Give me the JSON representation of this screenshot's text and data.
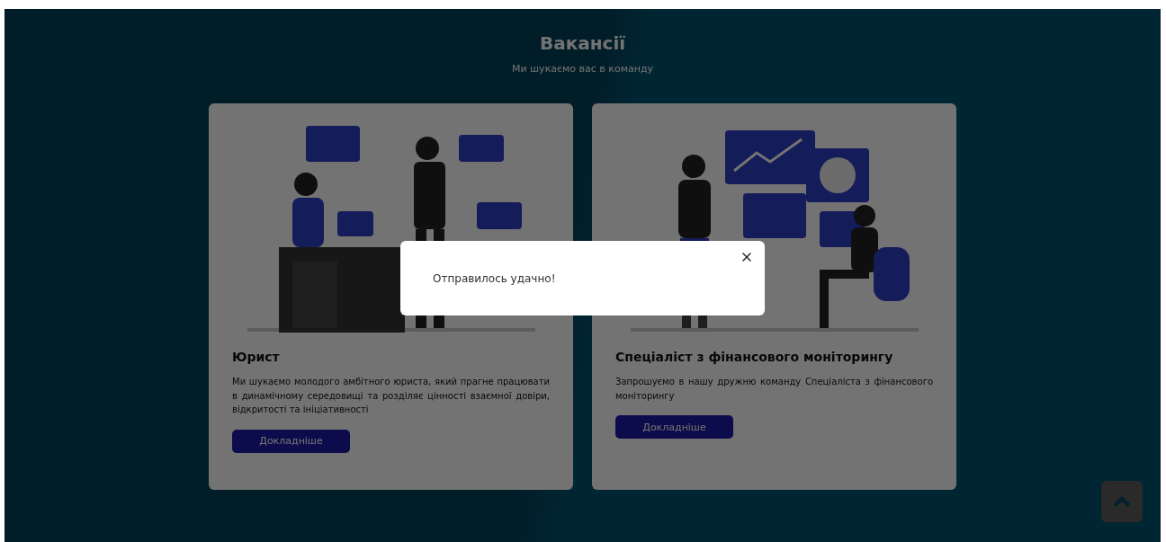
{
  "header": {
    "title": "Вакансії",
    "subtitle": "Ми шукаємо вас в команду"
  },
  "vacancies": [
    {
      "kind": "legal",
      "title": "Юрист",
      "description": "Ми шукаємо молодого амбітного юриста, який прагне працювати в динамічному середовищі та розділяє цінності взаємної довіри, відкритості та ініціативності",
      "button": "Докладніше"
    },
    {
      "kind": "finance",
      "title": "Спеціаліст з фінансового моніторингу",
      "description": "Запрошуємо в нашу дружню команду Спеціаліста з фінансового моніторингу",
      "button": "Докладніше"
    }
  ],
  "modal": {
    "message": "Отправилось удачно!"
  }
}
